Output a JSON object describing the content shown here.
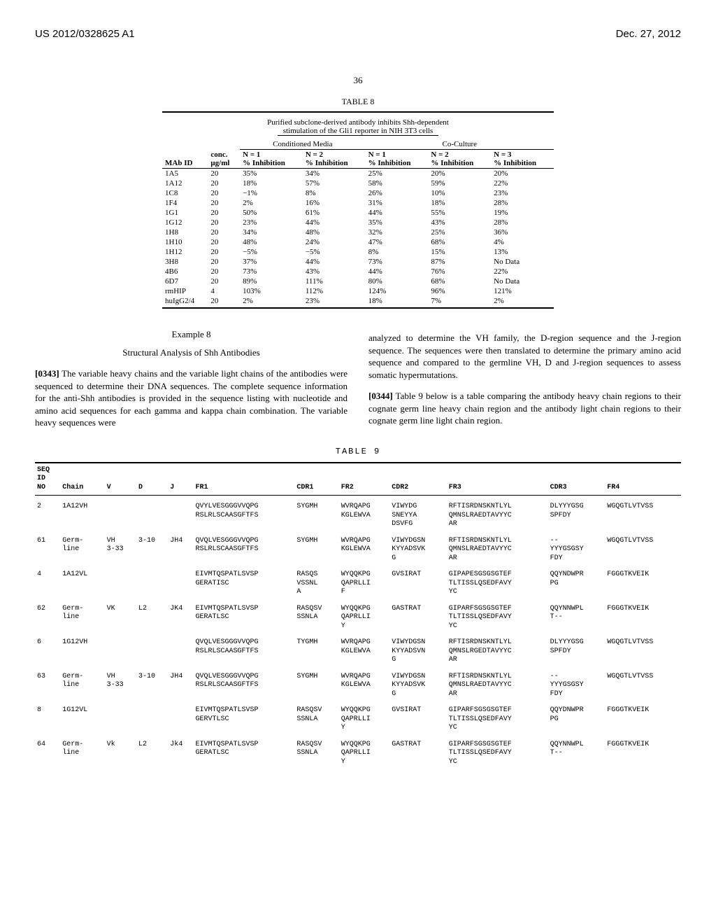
{
  "header": {
    "pub_number": "US 2012/0328625 A1",
    "pub_date": "Dec. 27, 2012",
    "page": "36"
  },
  "table8": {
    "label": "TABLE 8",
    "caption1": "Purified subclone-derived antibody inhibits Shh-dependent",
    "caption2": "stimulation of the Gli1 reporter in NIH 3T3 cells",
    "group1": "Conditioned Media",
    "group2": "Co-Culture",
    "headers": {
      "c1": "MAb ID",
      "c2a": "conc.",
      "c2b": "μg/ml",
      "c3a": "N = 1",
      "c3b": "% Inhibition",
      "c4a": "N = 2",
      "c4b": "% Inhibition",
      "c5a": "N = 1",
      "c5b": "% Inhibition",
      "c6a": "N = 2",
      "c6b": "% Inhibition",
      "c7a": "N = 3",
      "c7b": "% Inhibition"
    },
    "rows": [
      {
        "id": "1A5",
        "conc": "20",
        "cm1": "35%",
        "cm2": "34%",
        "cc1": "25%",
        "cc2": "20%",
        "cc3": "20%"
      },
      {
        "id": "1A12",
        "conc": "20",
        "cm1": "18%",
        "cm2": "57%",
        "cc1": "58%",
        "cc2": "59%",
        "cc3": "22%"
      },
      {
        "id": "1C8",
        "conc": "20",
        "cm1": "−1%",
        "cm2": "8%",
        "cc1": "26%",
        "cc2": "10%",
        "cc3": "23%"
      },
      {
        "id": "1F4",
        "conc": "20",
        "cm1": "2%",
        "cm2": "16%",
        "cc1": "31%",
        "cc2": "18%",
        "cc3": "28%"
      },
      {
        "id": "1G1",
        "conc": "20",
        "cm1": "50%",
        "cm2": "61%",
        "cc1": "44%",
        "cc2": "55%",
        "cc3": "19%"
      },
      {
        "id": "1G12",
        "conc": "20",
        "cm1": "23%",
        "cm2": "44%",
        "cc1": "35%",
        "cc2": "43%",
        "cc3": "28%"
      },
      {
        "id": "1H8",
        "conc": "20",
        "cm1": "34%",
        "cm2": "48%",
        "cc1": "32%",
        "cc2": "25%",
        "cc3": "36%"
      },
      {
        "id": "1H10",
        "conc": "20",
        "cm1": "48%",
        "cm2": "24%",
        "cc1": "47%",
        "cc2": "68%",
        "cc3": "4%"
      },
      {
        "id": "1H12",
        "conc": "20",
        "cm1": "−5%",
        "cm2": "−5%",
        "cc1": "8%",
        "cc2": "15%",
        "cc3": "13%"
      },
      {
        "id": "3H8",
        "conc": "20",
        "cm1": "37%",
        "cm2": "44%",
        "cc1": "73%",
        "cc2": "87%",
        "cc3": "No Data"
      },
      {
        "id": "4B6",
        "conc": "20",
        "cm1": "73%",
        "cm2": "43%",
        "cc1": "44%",
        "cc2": "76%",
        "cc3": "22%"
      },
      {
        "id": "6D7",
        "conc": "20",
        "cm1": "89%",
        "cm2": "111%",
        "cc1": "80%",
        "cc2": "68%",
        "cc3": "No Data"
      },
      {
        "id": "rmHIP",
        "conc": "4",
        "cm1": "103%",
        "cm2": "112%",
        "cc1": "124%",
        "cc2": "96%",
        "cc3": "121%"
      },
      {
        "id": "huIgG2/4",
        "conc": "20",
        "cm1": "2%",
        "cm2": "23%",
        "cc1": "18%",
        "cc2": "7%",
        "cc3": "2%"
      }
    ]
  },
  "body": {
    "example_num": "Example 8",
    "example_title": "Structural Analysis of Shh Antibodies",
    "p0343_num": "[0343]",
    "p0343": "   The variable heavy chains and the variable light chains of the antibodies were sequenced to determine their DNA sequences. The complete sequence information for the anti-Shh antibodies is provided in the sequence listing with nucleotide and amino acid sequences for each gamma and kappa chain combination. The variable heavy sequences were",
    "p_cont": "analyzed to determine the VH family, the D-region sequence and the J-region sequence. The sequences were then translated to determine the primary amino acid sequence and compared to the germline VH, D and J-region sequences to assess somatic hypermutations.",
    "p0344_num": "[0344]",
    "p0344": "   Table 9 below is a table comparing the antibody heavy chain regions to their cognate germ line heavy chain region and the antibody light chain regions to their cognate germ line light chain region."
  },
  "table9": {
    "label": "TABLE 9",
    "headers": {
      "seq": "SEQ\nID\nNO",
      "chain": "Chain",
      "v": "V",
      "d": "D",
      "j": "J",
      "fr1": "FR1",
      "cdr1": "CDR1",
      "fr2": "FR2",
      "cdr2": "CDR2",
      "fr3": "FR3",
      "cdr3": "CDR3",
      "fr4": "FR4"
    },
    "rows": [
      {
        "seq": "2",
        "chain": "1A12VH",
        "v": "",
        "d": "",
        "j": "",
        "fr1": "QVYLVESGGGVVQPG\nRSLRLSCAASGFTFS",
        "cdr1": "SYGMH",
        "fr2": "WVRQAPG\nKGLEWVA",
        "cdr2": "VIWYDG\nSNEYYA\nDSVFG",
        "fr3": "RFTISRDNSKNTLYL\nQMNSLRAEDTAVYYC\nAR",
        "cdr3": "DLYYYGSG\nSPFDY",
        "fr4": "WGQGTLVTVSS"
      },
      {
        "seq": "61",
        "chain": "Germ-\nline",
        "v": "VH\n3-33",
        "d": "3-10",
        "j": "JH4",
        "fr1": "QVQLVESGGGVVQPG\nRSLRLSCAASGFTFS",
        "cdr1": "SYGMH",
        "fr2": "WVRQAPG\nKGLEWVA",
        "cdr2": "VIWYDGSN\nKYYADSVK\nG",
        "fr3": "RFTISRDNSKNTLYL\nQMNSLRAEDTAVYYC\nAR",
        "cdr3": "--\nYYYGSGSY\nFDY",
        "fr4": "WGQGTLVTVSS"
      },
      {
        "seq": "4",
        "chain": "1A12VL",
        "v": "",
        "d": "",
        "j": "",
        "fr1": "EIVMTQSPATLSVSP\nGERATISC",
        "cdr1": "RASQS\nVSSNL\nA",
        "fr2": "WYQQKPG\nQAPRLLI\nF",
        "cdr2": "GVSIRAT",
        "fr3": "GIPAPESGSGSGTEF\nTLTISSLQSEDFAVY\nYC",
        "cdr3": "QQYNDWPR\nPG",
        "fr4": "FGGGTKVEIK"
      },
      {
        "seq": "62",
        "chain": "Germ-\nline",
        "v": "VK",
        "d": "L2",
        "j": "JK4",
        "fr1": "EIVMTQSPATLSVSP\nGERATLSC",
        "cdr1": "RASQSV\nSSNLA",
        "fr2": "WYQQKPG\nQAPRLLI\nY",
        "cdr2": "GASTRAT",
        "fr3": "GIPARFSGSGSGTEF\nTLTISSLQSEDFAVY\nYC",
        "cdr3": "QQYNNWPL\nT--",
        "fr4": "FGGGTKVEIK"
      },
      {
        "seq": "6",
        "chain": "1G12VH",
        "v": "",
        "d": "",
        "j": "",
        "fr1": "QVQLVESGGGVVQPG\nRSLRLSCAASGFTFS",
        "cdr1": "TYGMH",
        "fr2": "WVRQAPG\nKGLEWVA",
        "cdr2": "VIWYDGSN\nKYYADSVN\nG",
        "fr3": "RFTISRDNSKNTLYL\nQMNSLRGEDTAVYYC\nAR",
        "cdr3": "DLYYYGSG\nSPFDY",
        "fr4": "WGQGTLVTVSS"
      },
      {
        "seq": "63",
        "chain": "Germ-\nline",
        "v": "VH\n3-33",
        "d": "3-10",
        "j": "JH4",
        "fr1": "QVQLVESGGGVVQPG\nRSLRLSCAASGFTFS",
        "cdr1": "SYGMH",
        "fr2": "WVRQAPG\nKGLEWVA",
        "cdr2": "VIWYDGSN\nKYYADSVK\nG",
        "fr3": "RFTISRDNSKNTLYL\nQMNSLRAEDTAVYYC\nAR",
        "cdr3": "--\nYYYGSGSY\nFDY",
        "fr4": "WGQGTLVTVSS"
      },
      {
        "seq": "8",
        "chain": "1G12VL",
        "v": "",
        "d": "",
        "j": "",
        "fr1": "EIVMTQSPATLSVSP\nGERVTLSC",
        "cdr1": "RASQSV\nSSNLA",
        "fr2": "WYQQKPG\nQAPRLLI\nY",
        "cdr2": "GVSIRAT",
        "fr3": "GIPARFSGSGSGTEF\nTLTISSLQSEDFAVY\nYC",
        "cdr3": "QQYDNWPR\nPG",
        "fr4": "FGGGTKVEIK"
      },
      {
        "seq": "64",
        "chain": "Germ-\nline",
        "v": "Vk",
        "d": "L2",
        "j": "Jk4",
        "fr1": "EIVMTQSPATLSVSP\nGERATLSC",
        "cdr1": "RASQSV\nSSNLA",
        "fr2": "WYQQKPG\nQAPRLLI\nY",
        "cdr2": "GASTRAT",
        "fr3": "GIPARFSGSGSGTEF\nTLTISSLQSEDFAVY\nYC",
        "cdr3": "QQYNNWPL\nT--",
        "fr4": "FGGGTKVEIK"
      }
    ]
  }
}
